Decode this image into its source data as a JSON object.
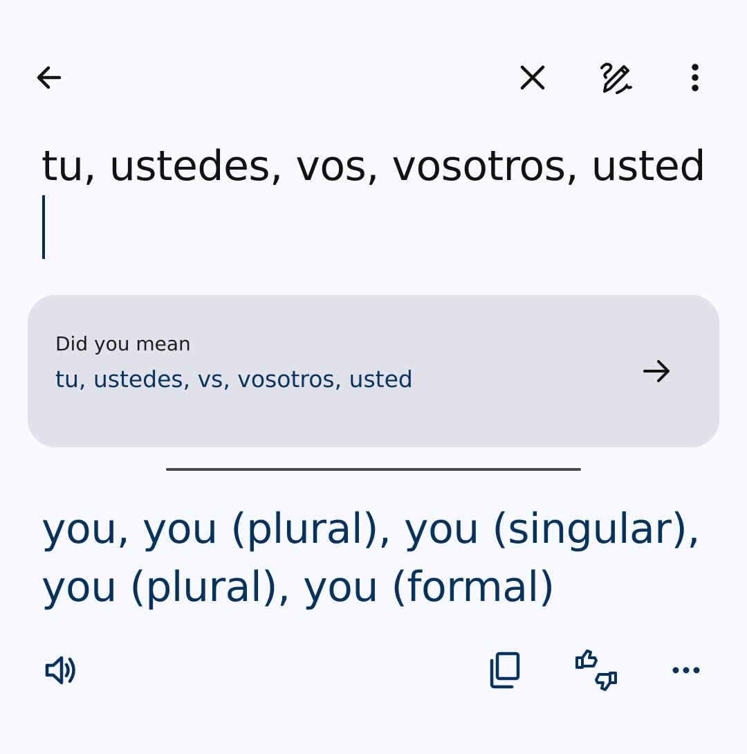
{
  "source": {
    "text": "tu, ustedes, vos, vosotros, usted"
  },
  "suggestion": {
    "heading": "Did you mean",
    "text": "tu, ustedes, vs, vosotros, usted"
  },
  "translation": {
    "text": "you, you (plural), you (singular), you (plural), you (formal)"
  },
  "icons": {
    "back": "arrow-back-icon",
    "clear": "close-icon",
    "handwrite": "handwriting-icon",
    "more": "more-vert-icon",
    "suggest_go": "arrow-forward-icon",
    "speak": "volume-icon",
    "copy": "copy-icon",
    "feedback": "thumbs-up-down-icon",
    "overflow": "more-horiz-icon"
  },
  "colors": {
    "background": "#f8f9fe",
    "card": "#e1e2e9",
    "accent_text": "#08325c",
    "primary_text": "#121212",
    "divider": "#45474f"
  }
}
